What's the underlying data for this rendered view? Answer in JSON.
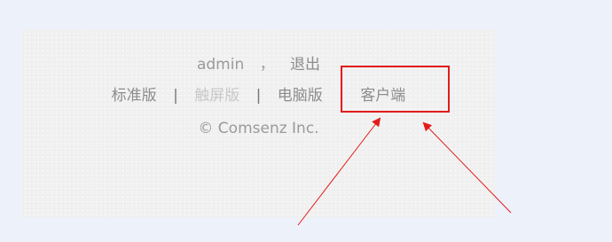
{
  "footer": {
    "user": {
      "username": "admin",
      "separator": "，",
      "logout_label": "退出"
    },
    "nav": [
      {
        "label": "标准版",
        "active": false
      },
      {
        "label": "触屏版",
        "active": true
      },
      {
        "label": "电脑版",
        "active": false
      },
      {
        "label": "客户端",
        "active": false
      }
    ],
    "divider": "|",
    "copyright": "© Comsenz Inc."
  },
  "annotation": {
    "box_color": "#e31b1b",
    "arrow_color": "#e31b1b",
    "highlighted_item": "客户端"
  }
}
